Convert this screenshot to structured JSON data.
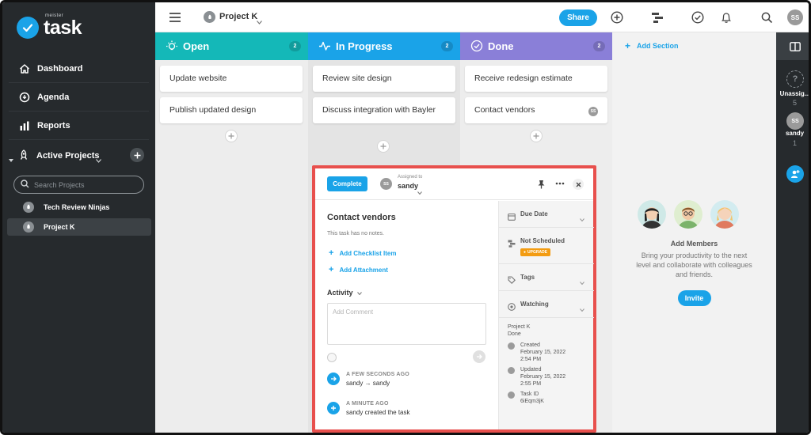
{
  "brand": {
    "small": "meister",
    "main": "task"
  },
  "sidebar": {
    "nav": [
      {
        "label": "Dashboard",
        "icon": "home-icon"
      },
      {
        "label": "Agenda",
        "icon": "agenda-icon"
      },
      {
        "label": "Reports",
        "icon": "reports-icon"
      }
    ],
    "active_projects_label": "Active Projects",
    "search_placeholder": "Search Projects",
    "projects": [
      {
        "label": "Tech Review Ninjas",
        "selected": false
      },
      {
        "label": "Project K",
        "selected": true
      }
    ]
  },
  "topbar": {
    "project_title": "Project K",
    "share_label": "Share",
    "avatar_initials": "SS"
  },
  "columns": [
    {
      "title": "Open",
      "count": "2",
      "color": "#14b8b8",
      "icon": "lightbulb-icon",
      "cards": [
        "Update website",
        "Publish updated design"
      ]
    },
    {
      "title": "In Progress",
      "count": "2",
      "color": "#1aa3e8",
      "icon": "pulse-icon",
      "cards": [
        "Review site design",
        "Discuss integration with Bayler"
      ]
    },
    {
      "title": "Done",
      "count": "2",
      "color": "#8a7fd8",
      "icon": "check-circle-icon",
      "cards": [
        "Receive redesign estimate",
        "Contact vendors"
      ]
    }
  ],
  "done_card_badge": "SS",
  "add_section_label": "Add Section",
  "members": {
    "title": "Add Members",
    "subtitle": "Bring your productivity to the next level and collaborate with colleagues and friends.",
    "invite_label": "Invite"
  },
  "right_rail": {
    "unassigned_label": "Unassig...",
    "unassigned_count": "5",
    "user_initials": "SS",
    "user_label": "sandy",
    "user_count": "1"
  },
  "task_panel": {
    "complete_label": "Complete",
    "assigned_to_label": "Assigned to",
    "assignee": "sandy",
    "assignee_initials": "SS",
    "title": "Contact vendors",
    "notes": "This task has no notes.",
    "add_checklist_label": "Add Checklist Item",
    "add_attachment_label": "Add Attachment",
    "activity_label": "Activity",
    "comment_placeholder": "Add Comment",
    "activity": [
      {
        "time": "A FEW SECONDS AGO",
        "text": "sandy → sandy"
      },
      {
        "time": "A MINUTE AGO",
        "text": "sandy created the task"
      }
    ],
    "side": {
      "due_date_label": "Due Date",
      "not_scheduled_label": "Not Scheduled",
      "upgrade_label": "UPGRADE",
      "tags_label": "Tags",
      "watching_label": "Watching",
      "project_name": "Project K",
      "section_name": "Done",
      "created_label": "Created",
      "created_date": "February 15, 2022",
      "created_time": "2:54 PM",
      "updated_label": "Updated",
      "updated_date": "February 15, 2022",
      "updated_time": "2:55 PM",
      "task_id_label": "Task ID",
      "task_id": "6iEqm3jK"
    }
  },
  "colors": {
    "accent": "#1aa3e8",
    "sidebar_bg": "#262a2d",
    "highlight_border": "#e8504d",
    "upgrade": "#f39c12"
  }
}
